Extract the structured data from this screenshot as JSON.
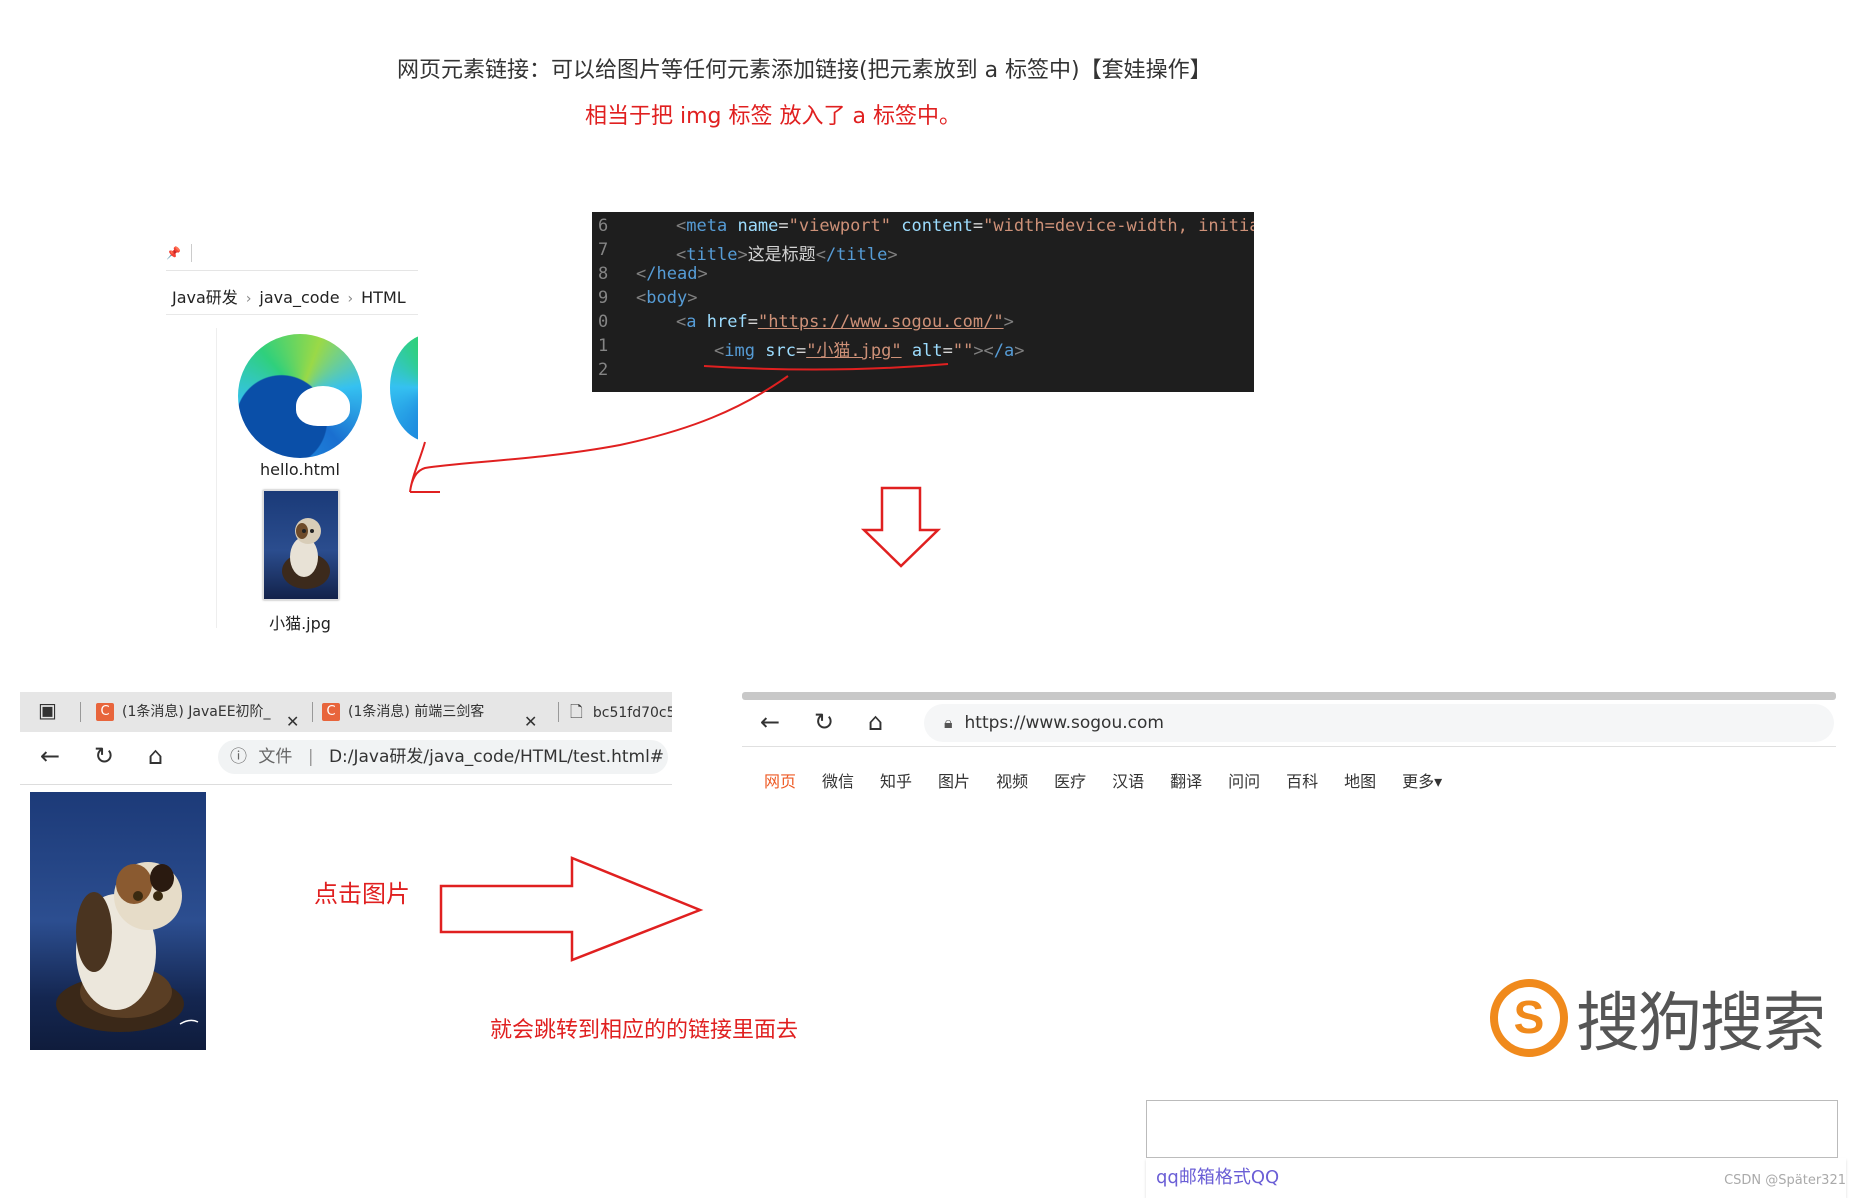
{
  "notes": {
    "line1": "网页元素链接：可以给图片等任何元素添加链接(把元素放到 a 标签中)【套娃操作】",
    "line2": "相当于把 img 标签 放入了 a 标签中。",
    "click_label": "点击图片",
    "jump_label": "就会跳转到相应的的链接里面去"
  },
  "explorer": {
    "breadcrumb": [
      "Java研发",
      "java_code",
      "HTML"
    ],
    "files": [
      {
        "name": "hello.html",
        "icon": "edge-browser-icon"
      },
      {
        "name": "小猫.jpg",
        "icon": "cat-image-thumbnail"
      }
    ]
  },
  "code": {
    "lines": [
      {
        "num": "6",
        "kind": "meta"
      },
      {
        "num": "7",
        "kind": "title"
      },
      {
        "num": "8",
        "kind": "head-close"
      },
      {
        "num": "9",
        "kind": "body"
      },
      {
        "num": "0",
        "kind": "a"
      },
      {
        "num": "1",
        "kind": "img"
      },
      {
        "num": "2",
        "kind": "blank"
      }
    ],
    "meta_tag": "meta",
    "meta_name_attr": "name",
    "meta_name_val": "\"viewport\"",
    "meta_content_attr": "content",
    "meta_content_val": "\"width=device-width, initial-",
    "title_open": "title",
    "title_text": "这是标题",
    "title_close": "/title",
    "head_close": "/head",
    "body_open": "body",
    "a_tag": "a",
    "a_href_attr": "href",
    "a_href_val": "\"https://www.sogou.com/\"",
    "img_tag": "img",
    "img_src_attr": "src",
    "img_src_val": "\"小猫.jpg\"",
    "img_alt_attr": "alt",
    "img_alt_val": "\"\"",
    "a_close": "/a"
  },
  "browser1": {
    "tabs": [
      {
        "label": "(1条消息) JavaEE初阶_"
      },
      {
        "label": "(1条消息) 前端三剑客"
      },
      {
        "label": "bc51fd70c5"
      }
    ],
    "file_label": "文件",
    "url": "D:/Java研发/java_code/HTML/test.html#"
  },
  "sogou": {
    "url": "https://www.sogou.com",
    "nav": [
      "网页",
      "微信",
      "知乎",
      "图片",
      "视频",
      "医疗",
      "汉语",
      "翻译",
      "问问",
      "百科",
      "地图",
      "更多▾"
    ],
    "logo_text": "搜狗搜索",
    "suggestion": "qq邮箱格式QQ"
  },
  "watermark": "CSDN @Später321",
  "colors": {
    "accent_red": "#e02020",
    "sogou_orange": "#f08a1c",
    "sogou_nav_active": "#ee5a24"
  }
}
